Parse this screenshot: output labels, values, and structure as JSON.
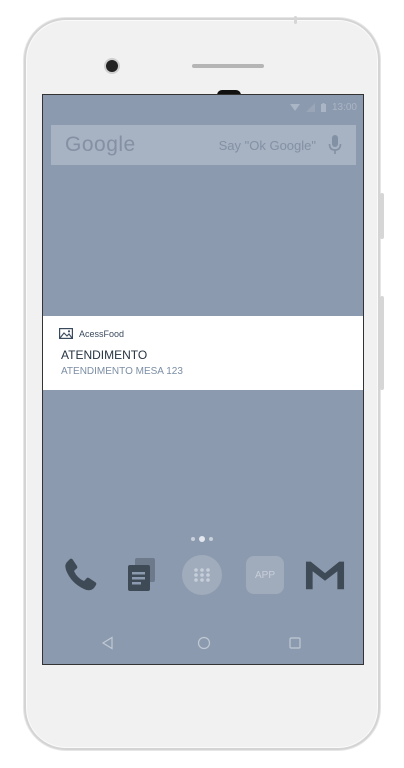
{
  "status_bar": {
    "time": "13:00"
  },
  "search": {
    "logo": "Google",
    "hint": "Say \"Ok Google\""
  },
  "notification": {
    "app_name": "AcessFood",
    "title": "ATENDIMENTO",
    "text": "ATENDIMENTO MESA 123"
  },
  "dock": {
    "items": [
      {
        "icon": "phone-icon"
      },
      {
        "icon": "notes-icon"
      },
      {
        "icon": "app-drawer-icon"
      },
      {
        "label": "APP"
      },
      {
        "icon": "gmail-icon"
      }
    ]
  },
  "nav": {
    "buttons": [
      "back",
      "home",
      "recents"
    ]
  },
  "colors": {
    "wallpaper": "#8b9aae",
    "search_bar": "#a7b2c2",
    "notification_bg": "#ffffff",
    "notification_text": "#7b8ea5"
  }
}
